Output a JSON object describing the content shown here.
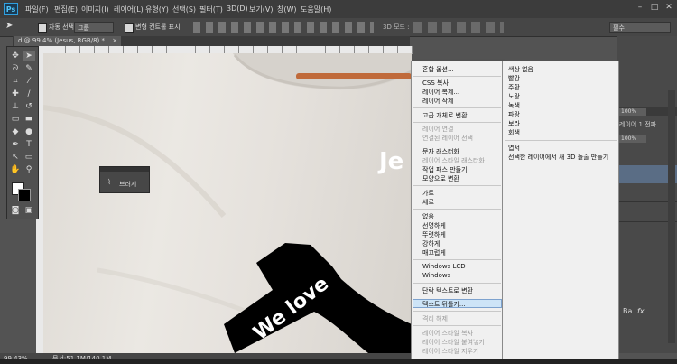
{
  "app": {
    "logo": "Ps"
  },
  "menu": [
    "파일(F)",
    "편집(E)",
    "이미지(I)",
    "레이어(L)",
    "유형(Y)",
    "선택(S)",
    "필터(T)",
    "3D(D)",
    "보기(V)",
    "창(W)",
    "도움말(H)"
  ],
  "options": {
    "auto_select_label": "자동 선택 :",
    "auto_select_value": "그룹",
    "transform_label": "변형 컨트롤 표시",
    "mode_label": "3D 모드 :",
    "workspace": "필수"
  },
  "document": {
    "tab_title": "d @ 99.4% (Jesus, RGB/8) *",
    "zoom": "99.43%",
    "doc_info": "문서:51.1M/140.1M",
    "overlay_text_white": "Je",
    "banner_text": "We love"
  },
  "brush_panel": {
    "label": "브러시"
  },
  "context_menu": {
    "items": [
      {
        "label": "혼합 옵션...",
        "disabled": false
      },
      {
        "label": "CSS 복사",
        "disabled": false
      },
      {
        "label": "레이어 복제...",
        "disabled": false
      },
      {
        "label": "레이어 삭제",
        "disabled": false
      },
      {
        "label": "고급 개체로 변환",
        "disabled": false
      },
      {
        "label": "레이어 연결",
        "disabled": true
      },
      {
        "label": "연결된 레이어 선택",
        "disabled": true
      },
      {
        "label": "문자 래스터화",
        "disabled": false
      },
      {
        "label": "레이어 스타일 래스터화",
        "disabled": true
      },
      {
        "label": "작업 패스 만들기",
        "disabled": false
      },
      {
        "label": "모양으로 변환",
        "disabled": false
      },
      {
        "label": "가로",
        "disabled": false
      },
      {
        "label": "세로",
        "disabled": false
      },
      {
        "label": "없음",
        "disabled": false
      },
      {
        "label": "선명하게",
        "disabled": false
      },
      {
        "label": "뚜렷하게",
        "disabled": false
      },
      {
        "label": "강하게",
        "disabled": false
      },
      {
        "label": "매끄럽게",
        "disabled": false
      },
      {
        "label": "Windows LCD",
        "disabled": false
      },
      {
        "label": "Windows",
        "disabled": false
      },
      {
        "label": "단락 텍스트로 변환",
        "disabled": false
      },
      {
        "label": "텍스트 뒤틀기...",
        "disabled": false
      },
      {
        "label": "격리 해제",
        "disabled": true
      },
      {
        "label": "레이어 스타일 복사",
        "disabled": true
      },
      {
        "label": "레이어 스타일 붙여넣기",
        "disabled": true
      },
      {
        "label": "레이어 스타일 지우기",
        "disabled": true
      }
    ]
  },
  "color_submenu": {
    "items": [
      "색상 없음",
      "빨강",
      "주황",
      "노랑",
      "녹색",
      "파랑",
      "보라",
      "회색",
      "엽서",
      "선택한 레이어에서 새 3D 돌출 만들기"
    ]
  },
  "right_panel": {
    "zoom_a": "100%",
    "layer_label": "레이어 1 전파",
    "zoom_b": "100%",
    "fx_label": "Ba"
  },
  "colors": {
    "highlight": "#cde4f7",
    "canvas": "#e6e2dd",
    "banner": "#000000"
  }
}
